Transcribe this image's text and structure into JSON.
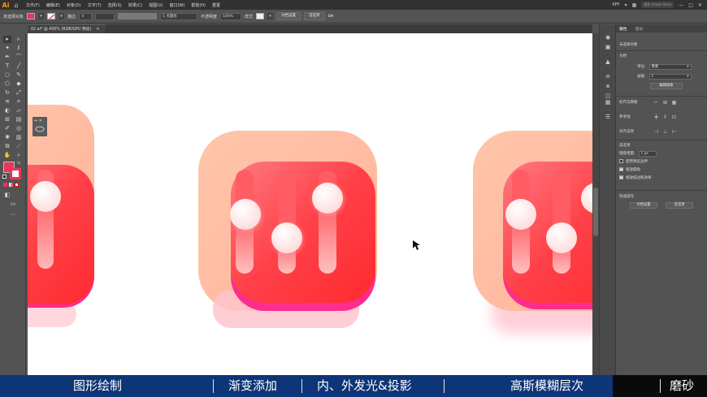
{
  "menubar": {
    "logo": "Ai",
    "items": [
      "文件(F)",
      "编辑(E)",
      "对象(O)",
      "文字(T)",
      "选择(S)",
      "效果(C)",
      "视图(V)",
      "窗口(W)",
      "帮助(H)",
      "重置"
    ],
    "workspace": "XPY",
    "search_placeholder": "搜索 Adobe Stock"
  },
  "controlbar": {
    "no_selection": "未选择对象",
    "stroke_label": "描边",
    "brush_value": "5 点圆形",
    "opacity_label": "不透明度",
    "opacity_value": "100%",
    "style_label": "样式",
    "doc_setup": "文档设置",
    "preferences": "首选项",
    "fill_color": "#e8365a"
  },
  "document": {
    "tab_title": "02.ai* @ 400% (RGB/GPU 预览)"
  },
  "properties": {
    "tab_active": "属性",
    "tab_inactive": "图层",
    "no_selection": "未选择对象",
    "document_section": "文档",
    "unit_label": "单位:",
    "unit_value": "像素",
    "artboard_label": "画板:",
    "artboard_value": "1",
    "edit_artboard_btn": "编辑画板",
    "ruler_grid": "标尺与网格",
    "guides": "参考线",
    "align": "对齐选项",
    "prefs": "首选项",
    "keyboard_increment_label": "键盘增量:",
    "keyboard_increment_value": "1 px",
    "check_preview_bounds": "使用预览边界",
    "check_scale_corners": "缩放圆角",
    "check_scale_strokes": "缩放描边和效果",
    "quick_actions": "快速操作",
    "doc_setup_btn": "文档设置",
    "prefs_btn": "首选项"
  },
  "subtitles": {
    "s1": "图形绘制",
    "s2": "渐变添加",
    "s3": "内、外发光&投影",
    "s4": "高斯模糊层次",
    "s5": "磨砂"
  },
  "colors": {
    "accent": "#e8365a",
    "subtitle_blue": "#0d3577",
    "back_panel": "#ffbfa3",
    "front_panel": "#ff3138",
    "knob": "#fff2f2"
  }
}
